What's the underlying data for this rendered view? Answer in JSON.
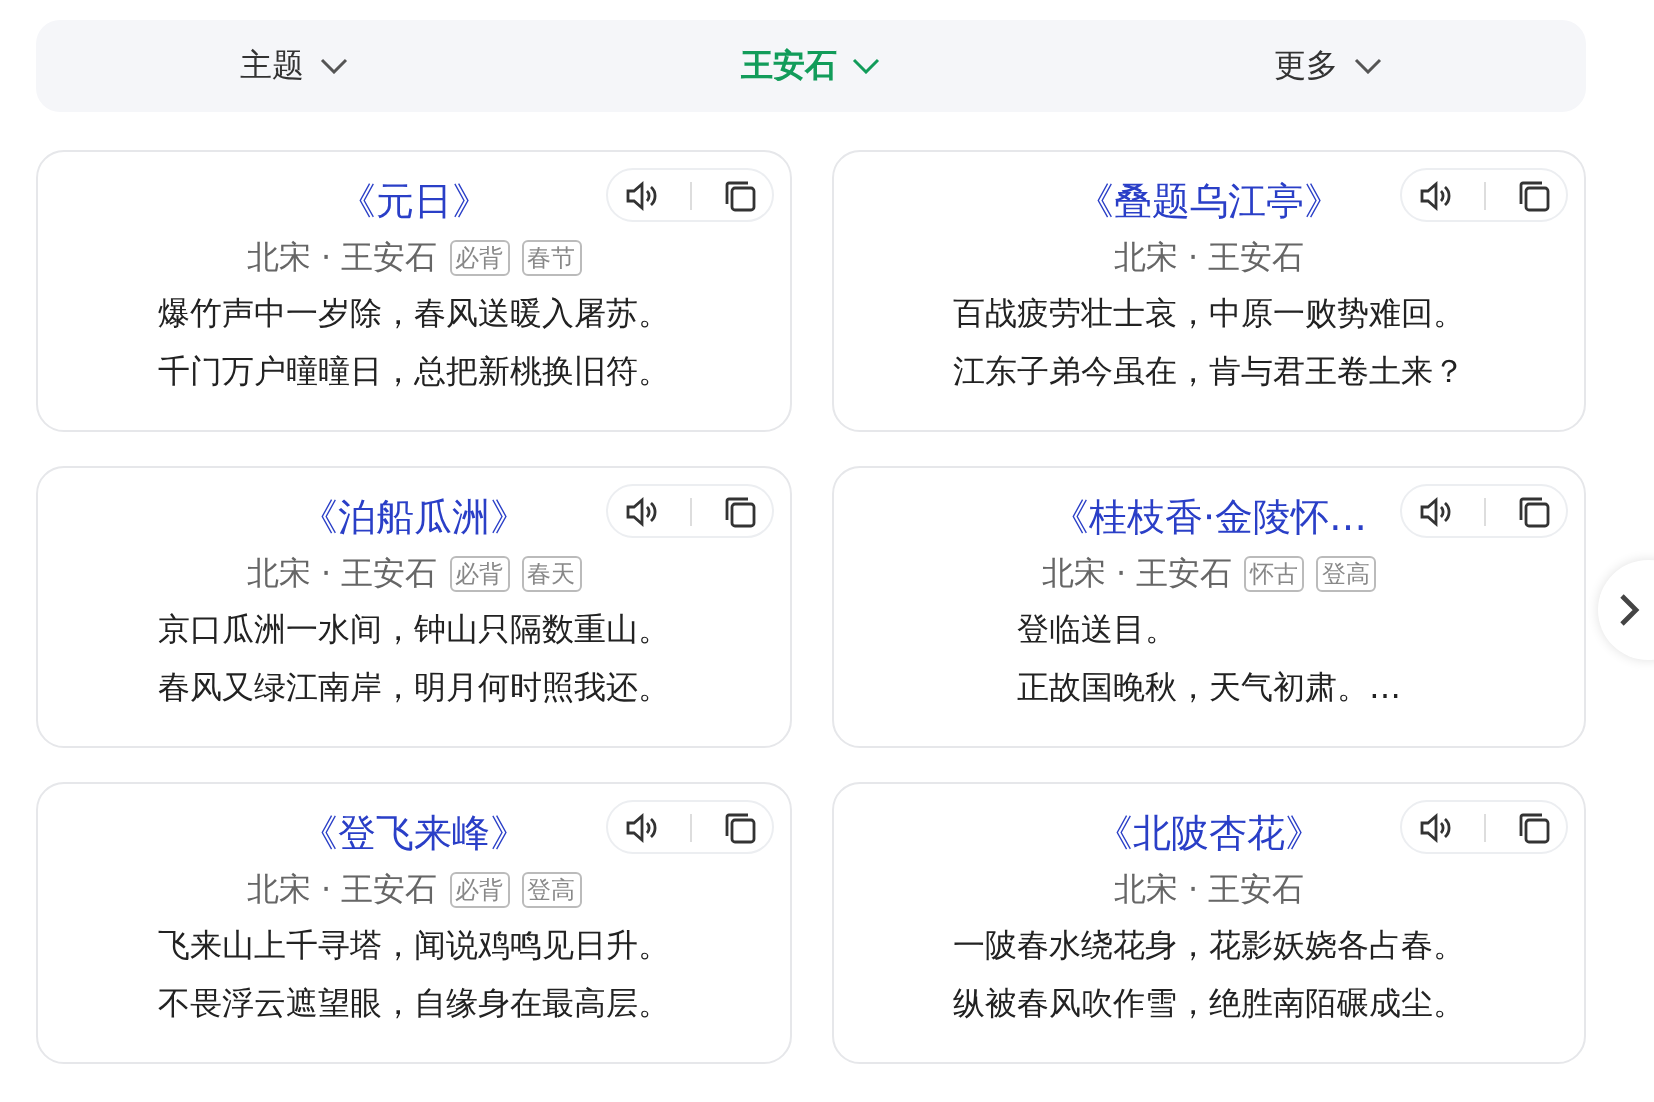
{
  "filters": [
    {
      "label": "主题",
      "selected": false
    },
    {
      "label": "王安石",
      "selected": true
    },
    {
      "label": "更多",
      "selected": false
    }
  ],
  "poems": [
    {
      "title": "《元日》",
      "byline": "北宋 · 王安石",
      "tags": [
        "必背",
        "春节"
      ],
      "lines": [
        "爆竹声中一岁除，春风送暖入屠苏。",
        "千门万户曈曈日，总把新桃换旧符。"
      ]
    },
    {
      "title": "《叠题乌江亭》",
      "byline": "北宋 · 王安石",
      "lines": [
        "百战疲劳壮士哀，中原一败势难回。",
        "江东子弟今虽在，肯与君王卷土来？"
      ]
    },
    {
      "title": "《泊船瓜洲》",
      "byline": "北宋 · 王安石",
      "tags": [
        "必背",
        "春天"
      ],
      "lines": [
        "京口瓜洲一水间，钟山只隔数重山。",
        "春风又绿江南岸，明月何时照我还。"
      ]
    },
    {
      "title": "《桂枝香·金陵怀…",
      "byline": "北宋 · 王安石",
      "tags": [
        "怀古",
        "登高"
      ],
      "lines": [
        "登临送目。",
        "正故国晚秋，天气初肃。…"
      ]
    },
    {
      "title": "《登飞来峰》",
      "byline": "北宋 · 王安石",
      "tags": [
        "必背",
        "登高"
      ],
      "lines": [
        "飞来山上千寻塔，闻说鸡鸣见日升。",
        "不畏浮云遮望眼，自缘身在最高层。"
      ]
    },
    {
      "title": "《北陂杏花》",
      "byline": "北宋 · 王安石",
      "lines": [
        "一陂春水绕花身，花影妖娆各占春。",
        "纵被春风吹作雪，绝胜南陌碾成尘。"
      ]
    }
  ]
}
